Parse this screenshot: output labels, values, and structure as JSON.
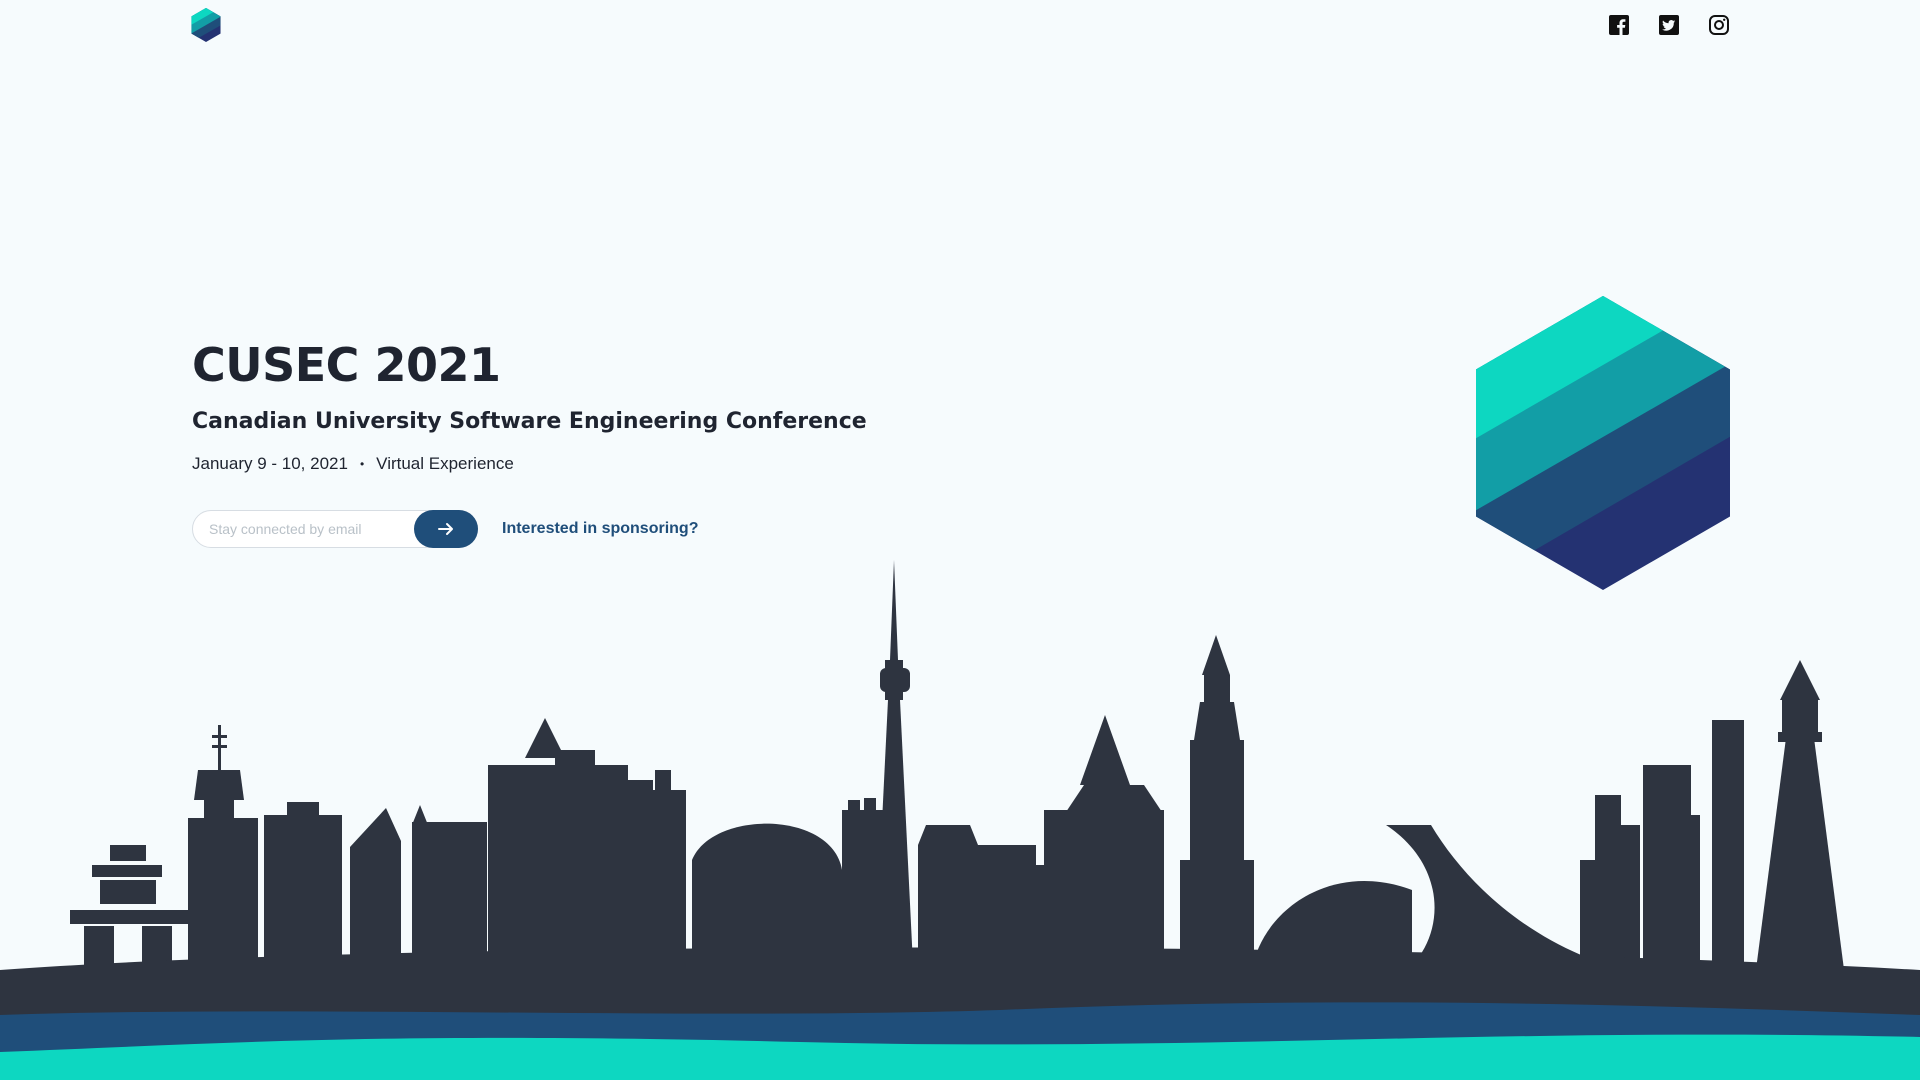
{
  "brand": {
    "logo_icon": "cusec-hexagon-logo-icon",
    "colors": {
      "teal": "#0dd7c1",
      "teal_dark": "#129ea6",
      "blue": "#1f4e7a",
      "navy": "#243272",
      "skyline": "#2e3440",
      "background": "#f6fbfd"
    }
  },
  "social": [
    {
      "icon": "facebook-icon"
    },
    {
      "icon": "twitter-icon"
    },
    {
      "icon": "instagram-icon"
    }
  ],
  "hero": {
    "title": "CUSEC 2021",
    "subtitle": "Canadian University Software Engineering Conference",
    "date": "January 9 - 10, 2021",
    "separator": "•",
    "location": "Virtual Experience"
  },
  "signup": {
    "placeholder": "Stay connected by email",
    "value": "",
    "submit_icon": "arrow-right-icon"
  },
  "sponsor_link": "Interested in sponsoring?",
  "illustration": {
    "skyline_icon": "canadian-city-skyline-illustration",
    "hexagon_icon": "cusec-hexagon-logo-icon"
  }
}
